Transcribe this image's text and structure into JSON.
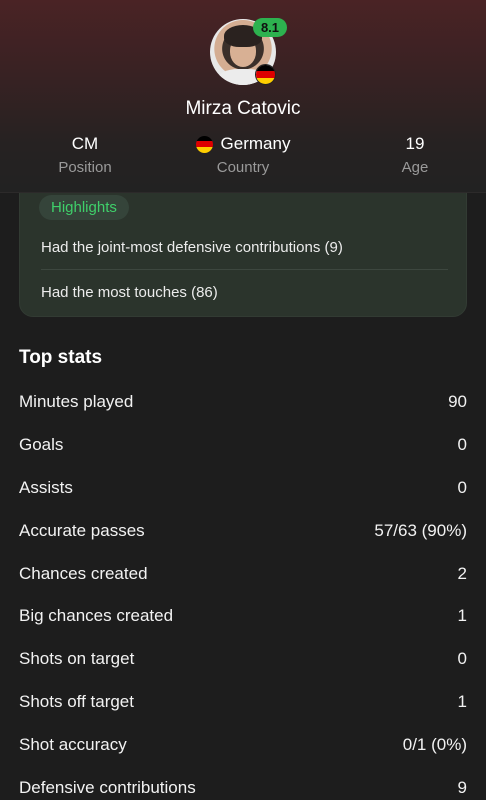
{
  "player": {
    "name": "Mirza Catovic",
    "rating": "8.1",
    "position_value": "CM",
    "position_label": "Position",
    "country_value": "Germany",
    "country_label": "Country",
    "age_value": "19",
    "age_label": "Age",
    "flag_colors": [
      "#000000",
      "#dd0000",
      "#ffce00"
    ],
    "rating_color": "#2db24f"
  },
  "highlights": {
    "title": "Highlights",
    "items": [
      "Had the joint-most defensive contributions (9)",
      "Had the most touches (86)"
    ]
  },
  "top_stats": {
    "title": "Top stats",
    "rows": [
      {
        "label": "Minutes played",
        "value": "90"
      },
      {
        "label": "Goals",
        "value": "0"
      },
      {
        "label": "Assists",
        "value": "0"
      },
      {
        "label": "Accurate passes",
        "value": "57/63 (90%)"
      },
      {
        "label": "Chances created",
        "value": "2"
      },
      {
        "label": "Big chances created",
        "value": "1"
      },
      {
        "label": "Shots on target",
        "value": "0"
      },
      {
        "label": "Shots off target",
        "value": "1"
      },
      {
        "label": "Shot accuracy",
        "value": "0/1 (0%)"
      },
      {
        "label": "Defensive contributions",
        "value": "9"
      }
    ]
  }
}
